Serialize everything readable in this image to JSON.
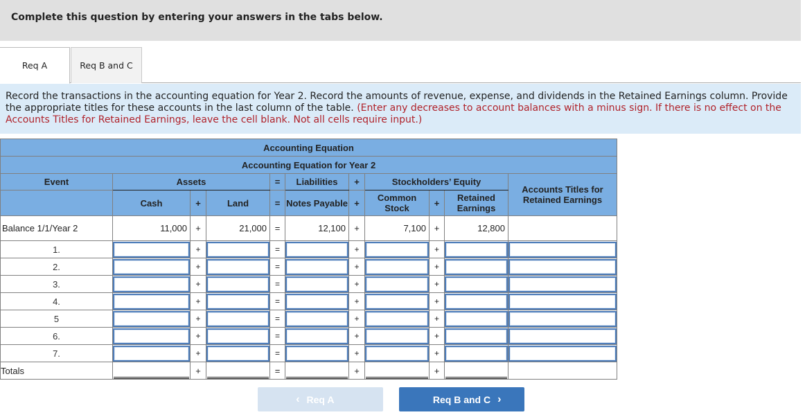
{
  "banner": {
    "text": "Complete this question by entering your answers in the tabs below."
  },
  "tabs": [
    {
      "label": "Req A",
      "active": true
    },
    {
      "label": "Req B and C",
      "active": false
    }
  ],
  "instructions": {
    "main": "Record the transactions in the accounting equation for Year 2. Record the amounts of revenue, expense, and dividends in the Retained Earnings column. Provide the appropriate titles for these accounts in the last column of the table.",
    "note": "(Enter any decreases to account balances with a minus sign. If there is no effect on the Accounts Titles for Retained Earnings, leave the cell blank. Not all cells require input.)"
  },
  "table": {
    "title": "Accounting Equation",
    "subtitle": "Accounting Equation for Year 2",
    "headers": {
      "event": "Event",
      "assets": "Assets",
      "liabilities": "Liabilities",
      "equity": "Stockholders’ Equity",
      "titles": "Accounts Titles for Retained Earnings",
      "cash": "Cash",
      "land": "Land",
      "notes_payable": "Notes Payable",
      "common_stock": "Common Stock",
      "retained_earnings": "Retained Earnings",
      "plus": "+",
      "equals": "="
    },
    "balance_row": {
      "event": "Balance 1/1/Year 2",
      "cash": "11,000",
      "land": "21,000",
      "notes_payable": "12,100",
      "common_stock": "7,100",
      "retained_earnings": "12,800",
      "titles": ""
    },
    "rows": [
      {
        "event": "1.",
        "cash": "",
        "land": "",
        "notes_payable": "",
        "common_stock": "",
        "retained_earnings": "",
        "titles": ""
      },
      {
        "event": "2.",
        "cash": "",
        "land": "",
        "notes_payable": "",
        "common_stock": "",
        "retained_earnings": "",
        "titles": ""
      },
      {
        "event": "3.",
        "cash": "",
        "land": "",
        "notes_payable": "",
        "common_stock": "",
        "retained_earnings": "",
        "titles": ""
      },
      {
        "event": "4.",
        "cash": "",
        "land": "",
        "notes_payable": "",
        "common_stock": "",
        "retained_earnings": "",
        "titles": ""
      },
      {
        "event": "5",
        "cash": "",
        "land": "",
        "notes_payable": "",
        "common_stock": "",
        "retained_earnings": "",
        "titles": ""
      },
      {
        "event": "6.",
        "cash": "",
        "land": "",
        "notes_payable": "",
        "common_stock": "",
        "retained_earnings": "",
        "titles": ""
      },
      {
        "event": "7.",
        "cash": "",
        "land": "",
        "notes_payable": "",
        "common_stock": "",
        "retained_earnings": "",
        "titles": ""
      }
    ],
    "totals_row": {
      "event": "Totals",
      "cash": "",
      "land": "",
      "notes_payable": "",
      "common_stock": "",
      "retained_earnings": ""
    }
  },
  "nav": {
    "prev_label": "Req A",
    "next_label": "Req B and C",
    "prev_icon": "chevron-left-icon",
    "next_icon": "chevron-right-icon"
  },
  "colors": {
    "header_bg": "#7aaee2",
    "instructions_bg": "#dbebf8",
    "note_red": "#b0222a",
    "next_button": "#3a76bb",
    "prev_button_disabled": "#d6e3f1",
    "input_border": "#4d7cb9"
  }
}
